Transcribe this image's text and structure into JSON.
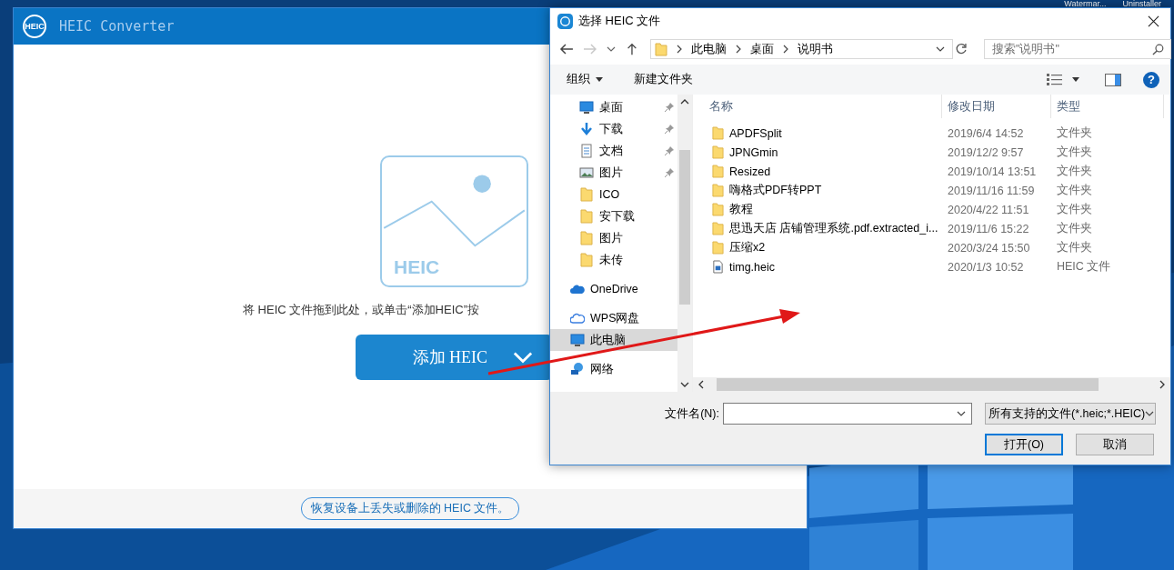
{
  "desktop": {
    "icons": [
      {
        "label": "Watermar..."
      },
      {
        "label": "Uninstaller"
      }
    ]
  },
  "app": {
    "logo_text": "HEIC",
    "title": "HEIC Converter",
    "illustration_text": "HEIC",
    "hint": "将 HEIC 文件拖到此处，或单击“添加HEIC”按",
    "add_button": "添加 HEIC",
    "recover_link": "恢复设备上丢失或删除的 HEIC 文件。"
  },
  "dialog": {
    "title": "选择 HEIC 文件",
    "nav": {
      "back_disabled": false,
      "forward_disabled": true
    },
    "breadcrumb": [
      "此电脑",
      "桌面",
      "说明书"
    ],
    "search": {
      "placeholder": "搜索\"说明书\""
    },
    "toolbar": {
      "organize": "组织",
      "new_folder": "新建文件夹",
      "help": "?"
    },
    "nav_pane": [
      {
        "label": "桌面",
        "kind": "desktop",
        "pinned": true,
        "selected": false
      },
      {
        "label": "下载",
        "kind": "download",
        "pinned": true,
        "selected": false
      },
      {
        "label": "文档",
        "kind": "document",
        "pinned": true,
        "selected": false
      },
      {
        "label": "图片",
        "kind": "pictures",
        "pinned": true,
        "selected": false
      },
      {
        "label": "ICO",
        "kind": "folder",
        "pinned": false,
        "selected": false
      },
      {
        "label": "安下载",
        "kind": "folder",
        "pinned": false,
        "selected": false
      },
      {
        "label": "图片",
        "kind": "folder",
        "pinned": false,
        "selected": false
      },
      {
        "label": "未传",
        "kind": "folder",
        "pinned": false,
        "selected": false
      },
      {
        "label": "OneDrive",
        "kind": "cloud",
        "pinned": false,
        "selected": false
      },
      {
        "label": "WPS网盘",
        "kind": "wps",
        "pinned": false,
        "selected": false
      },
      {
        "label": "此电脑",
        "kind": "computer",
        "pinned": false,
        "selected": true
      },
      {
        "label": "网络",
        "kind": "network",
        "pinned": false,
        "selected": false
      }
    ],
    "columns": [
      "名称",
      "修改日期",
      "类型"
    ],
    "files": [
      {
        "name": "APDFSplit",
        "date": "2019/6/4 14:52",
        "type": "文件夹",
        "kind": "folder"
      },
      {
        "name": "JPNGmin",
        "date": "2019/12/2 9:57",
        "type": "文件夹",
        "kind": "folder"
      },
      {
        "name": "Resized",
        "date": "2019/10/14 13:51",
        "type": "文件夹",
        "kind": "folder"
      },
      {
        "name": "嗨格式PDF转PPT",
        "date": "2019/11/16 11:59",
        "type": "文件夹",
        "kind": "folder"
      },
      {
        "name": "教程",
        "date": "2020/4/22 11:51",
        "type": "文件夹",
        "kind": "folder"
      },
      {
        "name": "思迅天店 店铺管理系统.pdf.extracted_i...",
        "date": "2019/11/6 15:22",
        "type": "文件夹",
        "kind": "folder"
      },
      {
        "name": "压缩x2",
        "date": "2020/3/24 15:50",
        "type": "文件夹",
        "kind": "folder"
      },
      {
        "name": "timg.heic",
        "date": "2020/1/3 10:52",
        "type": "HEIC 文件",
        "kind": "file"
      }
    ],
    "filename_label": "文件名(N):",
    "filter": "所有支持的文件(*.heic;*.HEIC)",
    "open_button": "打开(O)",
    "cancel_button": "取消"
  }
}
